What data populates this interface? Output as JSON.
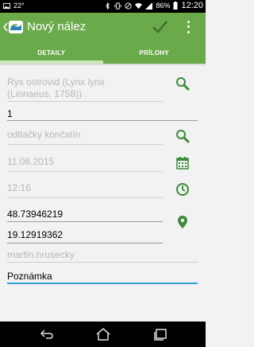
{
  "status": {
    "temperature": "22°",
    "battery": "86%",
    "time": "12:20"
  },
  "appbar": {
    "title": "Nový nález"
  },
  "tabs": [
    {
      "label": "DETAILY",
      "active": true
    },
    {
      "label": "PRÍLOHY",
      "active": false
    }
  ],
  "form": {
    "species": "Rys ostrovid (Lynx lynx\n(Linnaeus, 1758))",
    "count": "1",
    "evidence": "odtlačky končatín",
    "date": "11.06.2015",
    "time": "12:16",
    "latitude": "48.73946219",
    "longitude": "19.12919362",
    "user": "martin.hrusecky",
    "note_placeholder": "Poznámka"
  },
  "colors": {
    "accent": "#6aaa4b",
    "icon": "#3d8a3a",
    "focus": "#33a0d6"
  },
  "icons": [
    "search-icon",
    "calendar-icon",
    "clock-icon",
    "location-pin-icon",
    "checkmark-icon",
    "overflow-menu-icon",
    "back-icon",
    "home-icon",
    "recent-apps-icon"
  ]
}
